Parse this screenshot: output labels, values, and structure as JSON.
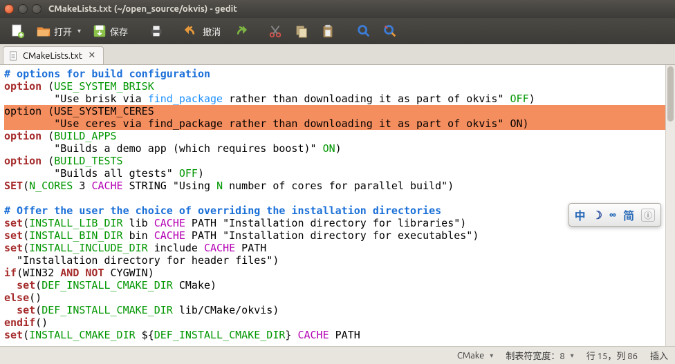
{
  "window": {
    "title": "CMakeLists.txt (~/open_source/okvis) - gedit"
  },
  "toolbar": {
    "open_label": "打开",
    "save_label": "保存",
    "undo_label": "撤消"
  },
  "tab": {
    "filename": "CMakeLists.txt"
  },
  "statusbar": {
    "lang": "CMake",
    "tabwidth_label": "制表符宽度：8",
    "position": "行 15，列 86",
    "mode": "插入"
  },
  "ime": {
    "items": [
      "中",
      "☽",
      "∞",
      "简",
      "ⓘ"
    ]
  },
  "code": {
    "l1_comment": "# options for build configuration",
    "l2_a": "option",
    "l2_b": " (",
    "l2_c": "USE_SYSTEM_BRISK",
    "l3_a": "        \"Use brisk via ",
    "l3_b": "find_package",
    "l3_c": " rather than downloading it as part of okvis\" ",
    "l3_d": "OFF",
    "l3_e": ")",
    "l4_all": "option (USE_SYSTEM_CERES",
    "l5_all": "        \"Use ceres via find_package rather than downloading it as part of okvis\" ON)",
    "l6_a": "option",
    "l6_b": " (",
    "l6_c": "BUILD_APPS",
    "l7_a": "        \"Builds a demo app (which requires boost)\" ",
    "l7_b": "ON",
    "l7_c": ")",
    "l8_a": "option",
    "l8_b": " (",
    "l8_c": "BUILD_TESTS",
    "l9_a": "        \"Builds all gtests\" ",
    "l9_b": "OFF",
    "l9_c": ")",
    "l10_a": "SET",
    "l10_b": "(",
    "l10_c": "N_CORES",
    "l10_d": " 3 ",
    "l10_e": "CACHE",
    "l10_f": " STRING \"Using ",
    "l10_g": "N",
    "l10_h": " number of cores for parallel build\")",
    "l12_comment": "# Offer the user the choice of overriding the installation directories",
    "l13_a": "set",
    "l13_b": "(",
    "l13_c": "INSTALL_LIB_DIR",
    "l13_d": " lib ",
    "l13_e": "CACHE",
    "l13_f": " PATH \"Installation directory for libraries\")",
    "l14_a": "set",
    "l14_b": "(",
    "l14_c": "INSTALL_BIN_DIR",
    "l14_d": " bin ",
    "l14_e": "CACHE",
    "l14_f": " PATH \"Installation directory for executables\")",
    "l15_a": "set",
    "l15_b": "(",
    "l15_c": "INSTALL_INCLUDE_DIR",
    "l15_d": " include ",
    "l15_e": "CACHE",
    "l15_f": " PATH",
    "l16_a": "  \"Installation directory for header files\")",
    "l17_a": "if",
    "l17_b": "(WIN32 ",
    "l17_c": "AND",
    "l17_d": " ",
    "l17_e": "NOT",
    "l17_f": " CYGWIN)",
    "l18_a": "  ",
    "l18_b": "set",
    "l18_c": "(",
    "l18_d": "DEF_INSTALL_CMAKE_DIR",
    "l18_e": " CMake)",
    "l19_a": "else",
    "l19_b": "()",
    "l20_a": "  ",
    "l20_b": "set",
    "l20_c": "(",
    "l20_d": "DEF_INSTALL_CMAKE_DIR",
    "l20_e": " lib/CMake/okvis)",
    "l21_a": "endif",
    "l21_b": "()",
    "l22_a": "set",
    "l22_b": "(",
    "l22_c": "INSTALL_CMAKE_DIR",
    "l22_d": " ${",
    "l22_e": "DEF_INSTALL_CMAKE_DIR",
    "l22_f": "} ",
    "l22_g": "CACHE",
    "l22_h": " PATH"
  }
}
